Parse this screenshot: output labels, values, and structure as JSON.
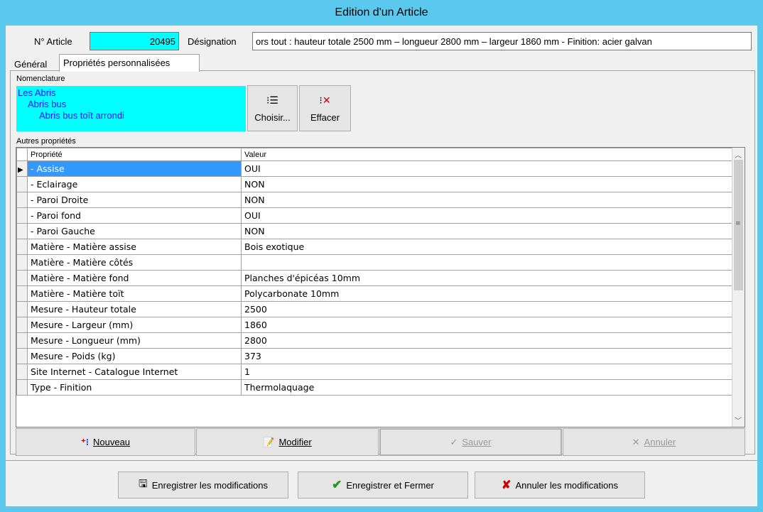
{
  "window": {
    "title": "Edition d'un Article"
  },
  "header": {
    "article_no_label": "N° Article",
    "article_no_value": "20495",
    "designation_label": "Désignation",
    "designation_value": "ors tout : hauteur totale 2500 mm – longueur 2800 mm – largeur 1860 mm - Finition: acier galvan"
  },
  "tabs": [
    {
      "label": "Général"
    },
    {
      "label": "Propriétés personnalisées"
    }
  ],
  "nomenclature": {
    "label": "Nomenclature",
    "lines": [
      "Les Abris",
      "Abris bus",
      "Abris bus toït arrondi"
    ],
    "choose_label": "Choisir...",
    "clear_label": "Effacer"
  },
  "properties": {
    "label": "Autres propriétés",
    "col_property": "Propriété",
    "col_value": "Valeur",
    "rows": [
      {
        "p": " - Assise",
        "v": "OUI"
      },
      {
        "p": " - Eclairage",
        "v": "NON"
      },
      {
        "p": " - Paroi Droite",
        "v": "NON"
      },
      {
        "p": " - Paroi fond",
        "v": "OUI"
      },
      {
        "p": " - Paroi Gauche",
        "v": "NON"
      },
      {
        "p": "Matière - Matière assise",
        "v": "Bois exotique"
      },
      {
        "p": "Matière - Matière côtés",
        "v": ""
      },
      {
        "p": "Matière - Matière fond",
        "v": "Planches d'épicéas 10mm"
      },
      {
        "p": "Matière - Matière toït",
        "v": "Polycarbonate 10mm"
      },
      {
        "p": "Mesure - Hauteur totale",
        "v": "2500"
      },
      {
        "p": "Mesure - Largeur (mm)",
        "v": "1860"
      },
      {
        "p": "Mesure - Longueur (mm)",
        "v": "2800"
      },
      {
        "p": "Mesure - Poids (kg)",
        "v": "373"
      },
      {
        "p": "Site Internet - Catalogue Internet",
        "v": "1"
      },
      {
        "p": "Type - Finition",
        "v": "Thermolaquage"
      }
    ]
  },
  "actions": {
    "new": "Nouveau",
    "edit": "Modifier",
    "save": "Sauver",
    "cancel": "Annuler"
  },
  "footer": {
    "save_changes": "Enregistrer les modifications",
    "save_close": "Enregistrer et Fermer",
    "cancel_changes": "Annuler les modifications"
  },
  "colors": {
    "titlebar": "#5bc8ee",
    "cyan_field": "#00ffff",
    "selection": "#3399ff"
  }
}
